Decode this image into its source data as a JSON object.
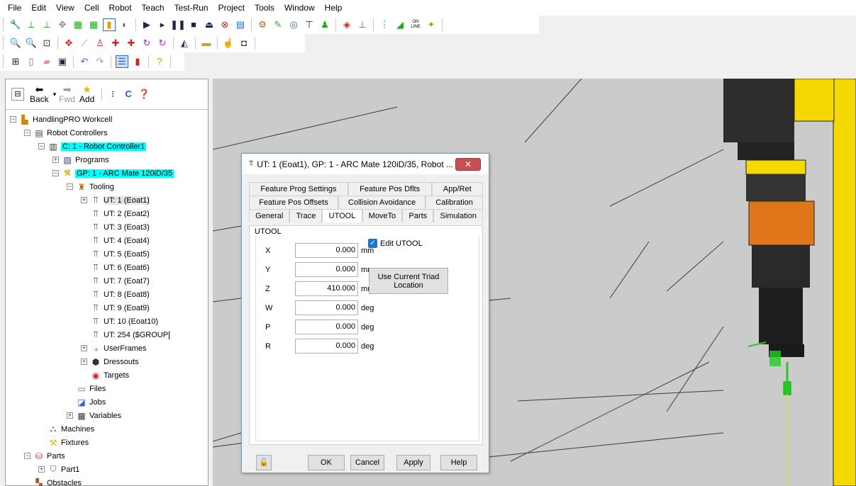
{
  "menubar": [
    "File",
    "Edit",
    "View",
    "Cell",
    "Robot",
    "Teach",
    "Test-Run",
    "Project",
    "Tools",
    "Window",
    "Help"
  ],
  "toolbar3_text": {
    "on_line_top": "ON",
    "on_line_bottom": "LINE"
  },
  "nav": {
    "back": "Back",
    "fwd": "Fwd",
    "add": "Add"
  },
  "tree": {
    "workcell": "HandlingPRO Workcell",
    "robot_controllers": "Robot Controllers",
    "controller": "C: 1 - Robot Controller1",
    "programs": "Programs",
    "group": "GP: 1 - ARC Mate 120iD/35",
    "tooling": "Tooling",
    "ut_items": [
      "UT: 1  (Eoat1)",
      "UT: 2  (Eoat2)",
      "UT: 3  (Eoat3)",
      "UT: 4  (Eoat4)",
      "UT: 5  (Eoat5)",
      "UT: 6  (Eoat6)",
      "UT: 7  (Eoat7)",
      "UT: 8  (Eoat8)",
      "UT: 9  (Eoat9)",
      "UT: 10  (Eoat10)",
      "UT: 254  ($GROUP["
    ],
    "userframes": "UserFrames",
    "dressouts": "Dressouts",
    "targets": "Targets",
    "files": "Files",
    "jobs": "Jobs",
    "variables": "Variables",
    "machines": "Machines",
    "fixtures": "Fixtures",
    "parts": "Parts",
    "part1": "Part1",
    "obstacles": "Obstacles"
  },
  "dialog": {
    "title": "UT: 1  (Eoat1), GP: 1 - ARC Mate 120iD/35, Robot ...",
    "close": "✕",
    "tabs_row1": [
      "Feature Prog Settings",
      "Feature Pos Dflts",
      "App/Ret"
    ],
    "tabs_row2": [
      "Feature Pos Offsets",
      "Collision Avoidance",
      "Calibration"
    ],
    "tabs_row3": [
      "General",
      "Trace",
      "UTOOL",
      "MoveTo",
      "Parts",
      "Simulation"
    ],
    "active_tab": "UTOOL",
    "group_label": "UTOOL",
    "fields": [
      {
        "label": "X",
        "value": "0.000",
        "unit": "mm"
      },
      {
        "label": "Y",
        "value": "0.000",
        "unit": "mm"
      },
      {
        "label": "Z",
        "value": "410.000",
        "unit": "mm"
      },
      {
        "label": "W",
        "value": "0.000",
        "unit": "deg"
      },
      {
        "label": "P",
        "value": "0.000",
        "unit": "deg"
      },
      {
        "label": "R",
        "value": "0.000",
        "unit": "deg"
      }
    ],
    "edit_utool": "Edit UTOOL",
    "edit_utool_checked": true,
    "use_triad": "Use Current Triad\nLocation",
    "ok": "OK",
    "cancel": "Cancel",
    "apply": "Apply",
    "help": "Help"
  },
  "colors": {
    "highlight": "#00ffff",
    "robot_yellow": "#f5d800",
    "robot_orange": "#e0761a",
    "triad_green": "#22cc22"
  }
}
